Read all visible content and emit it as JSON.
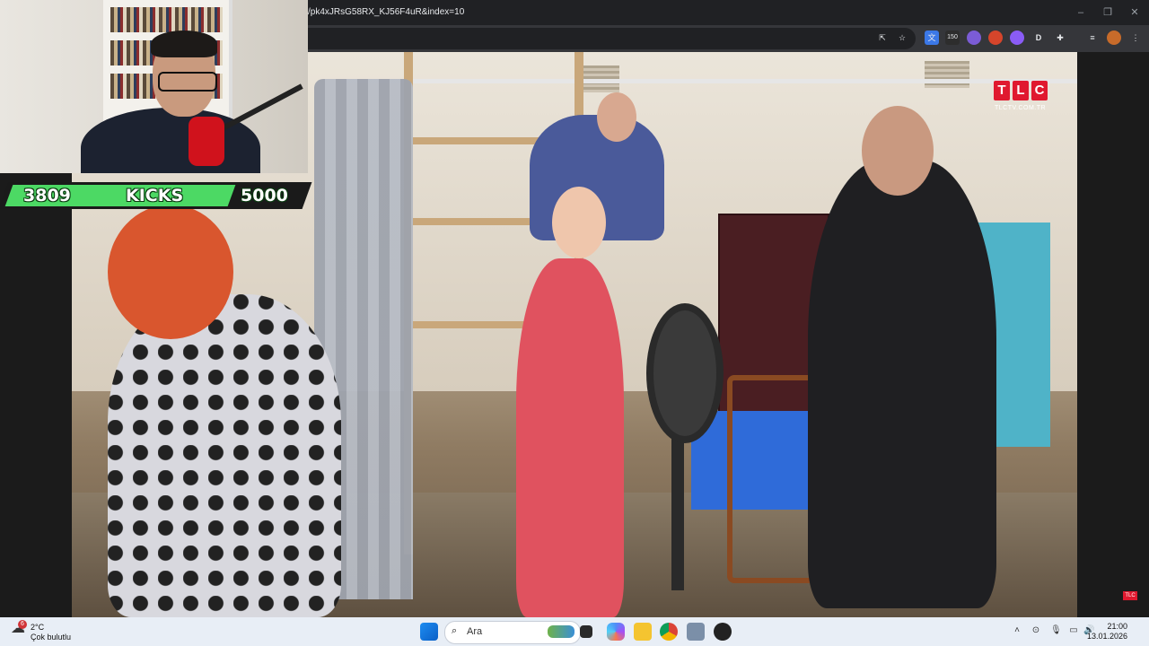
{
  "browser": {
    "url": "/pk4xJRsG58RX_KJ56F4uR&index=10",
    "window_controls": [
      "minimize",
      "restore",
      "close"
    ],
    "toolbar_icons": [
      "cast-icon",
      "star-icon",
      "translate-icon",
      "extension-150-icon",
      "shield-icon",
      "fox-icon",
      "cloud-icon",
      "d-icon",
      "puzzle-icon",
      "queue-icon",
      "profile-avatar",
      "menu-icon"
    ],
    "extension_badge": "150"
  },
  "video": {
    "channel_logo_letters": [
      "T",
      "L",
      "C"
    ],
    "channel_url": "TLCTV.COM.TR",
    "small_logo": "TLC"
  },
  "overlay": {
    "kicks_current": "3809",
    "kicks_label": "KICKS",
    "kicks_goal": "5000",
    "kicks_progress": 0.7618,
    "bar_color": "#4cd964"
  },
  "taskbar": {
    "weather_badge": "6",
    "temperature": "2°C",
    "weather_desc": "Çok bulutlu",
    "search_placeholder": "Ara",
    "apps": [
      "windows-start-icon",
      "task-view-icon",
      "copilot-icon",
      "file-explorer-icon",
      "chrome-icon",
      "snipping-icon",
      "obs-icon"
    ],
    "time": "21:00",
    "date": "13.01.2026"
  }
}
